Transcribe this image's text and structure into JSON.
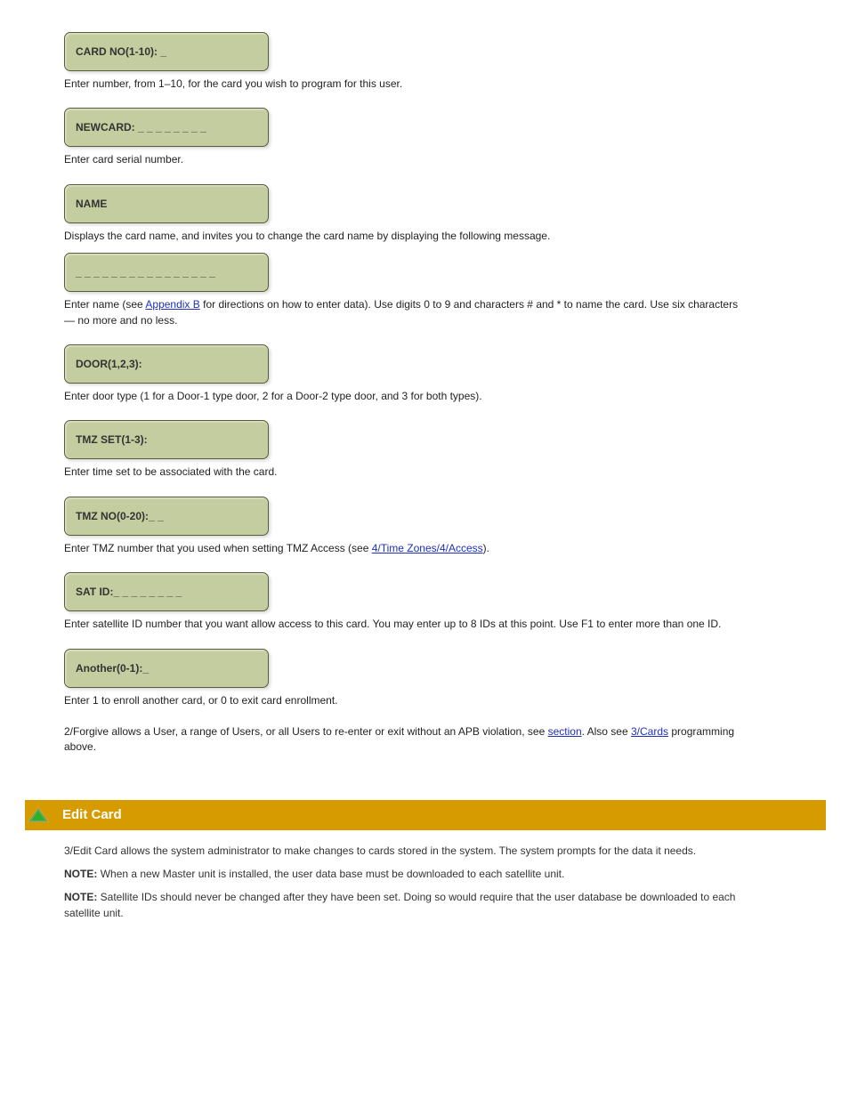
{
  "lcds": {
    "card_no": "CARD NO(1-10): _",
    "newcard": "NEWCARD: _ _ _ _ _ _ _ _",
    "name": "NAME",
    "name_blank": "_ _ _ _ _ _ _ _ _ _ _ _ _ _ _ _",
    "door": "DOOR(1,2,3):",
    "tmz_set": "TMZ SET(1-3):",
    "tmz_no": "TMZ NO(0-20):_ _",
    "sat_id": "SAT ID:_ _ _ _ _ _ _ _",
    "another": "Another(0-1):_"
  },
  "text": {
    "card_no_desc": "Enter number, from 1–10, for the card you wish to program for this user.",
    "newcard_desc": "Enter card serial number.",
    "name_label_desc": "Displays the card name, and invites you to change the card name by displaying the following message.",
    "name_blank_desc_pre": "Enter name (see ",
    "name_blank_link": "Appendix B",
    "name_blank_desc_post": " for directions on how to enter data). Use digits 0 to 9 and characters # and * to name the card. Use six characters — no more and no less.",
    "door_desc": "Enter door type (1 for a Door-1 type door, 2 for a Door-2 type door, and 3 for both types).",
    "tmz_set_desc": "Enter time set to be associated with the card.",
    "tmz_no_desc_pre": "Enter TMZ number that you used when setting TMZ Access (see ",
    "tmz_no_link": "4/Time Zones/4/Access",
    "tmz_no_desc_post": ").",
    "sat_id_desc": "Enter satellite ID number that you want allow access to this card. You may enter up to 8 IDs at this point. Use F1 to enter more than one ID.",
    "another_desc": "Enter 1 to enroll another card, or 0 to exit card enrollment.",
    "forgive_desc_pre_1": "2/Forgive ",
    "forgive_desc_1": "allows a User, a range of Users, or all Users to re-enter or exit without an APB violation, see ",
    "forgive_link_1": "section",
    "forgive_desc_2": ". Also see ",
    "forgive_link_2": "3/Cards",
    "forgive_desc_3": " programming above."
  },
  "header": {
    "title": "Edit Card"
  },
  "header_desc": "3/Edit Card allows the system administrator to make changes to cards stored in the system. The system prompts for the data it needs.",
  "notes": {
    "label": "NOTE:",
    "n1": "When a new Master unit is installed, the user data base must be downloaded to each satellite unit.",
    "n2_pre": "NOTE: ",
    "n2": "Satellite IDs should never be changed after they have been set. Doing so would require that the user database be downloaded to each satellite unit."
  }
}
